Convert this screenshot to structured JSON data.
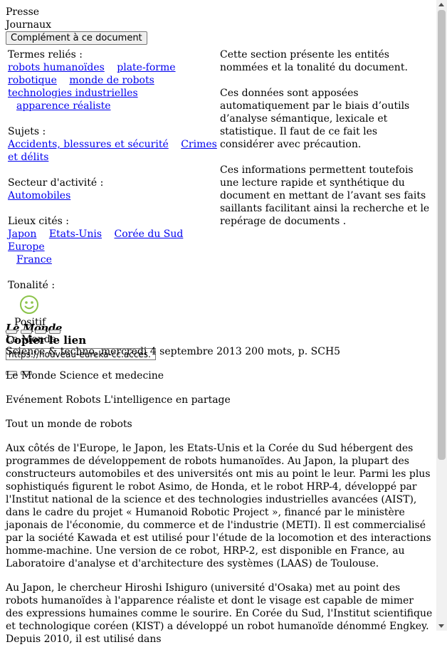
{
  "nav": {
    "presse": "Presse",
    "journaux": "Journaux",
    "complement_button": "Complément à ce document"
  },
  "complement": {
    "related_terms": {
      "label": "Termes reliés :",
      "items": [
        "robots humanoïdes",
        "plate-forme robotique",
        "monde de robots",
        "technologies industrielles",
        "apparence réaliste"
      ]
    },
    "subjects": {
      "label": "Sujets :",
      "items": [
        "Accidents, blessures et sécurité",
        "Crimes et délits"
      ]
    },
    "sector": {
      "label": "Secteur d'activité :",
      "items": [
        "Automobiles"
      ]
    },
    "places": {
      "label": "Lieux cités :",
      "items": [
        "Japon",
        "Etats-Unis",
        "Corée du Sud",
        "Europe",
        "France"
      ]
    },
    "tonality": {
      "label": "Tonalité :",
      "value": "Positif",
      "icon": "smiley-icon",
      "color": "#8bc34a"
    },
    "info": [
      "Cette section présente les entités nommées et la tonalité du document.",
      "Ces données sont apposées automatiquement par le biais d’outils d’analyse sémantique, lexicale et statistique. Il faut de ce fait les considérer avec précaution.",
      "Ces informations permettent toutefois une lecture rapide et synthétique du document en mettant de l’avant ses faits saillants facilitant ainsi la recherche et le repérage de documents ."
    ]
  },
  "document": {
    "logo": "Le Monde",
    "copy_link_title": "Copier le lien",
    "source_name": "Le Monde",
    "url_value": "https://nouveau-eureka-cc.acces.",
    "meta": "Science & techno, mercredi 4 septembre 2013 200 mots, p. SCH5",
    "supplement": "Le Monde Science et medecine",
    "section": "Evénement Robots L'intelligence en partage",
    "title": "Tout un monde de robots",
    "paragraphs": [
      "Aux côtés de l'Europe, le Japon, les Etats-Unis et la Corée du Sud hébergent des programmes de développement de robots humanoïdes. Au Japon, la plupart des constructeurs automobiles et des universités ont mis au point le leur. Parmi les plus sophistiqués figurent le robot Asimo, de Honda, et le robot HRP-4, développé par l'Institut national de la science et des technologies industrielles avancées (AIST), dans le cadre du projet « Humanoid Robotic Project », financé par le ministère japonais de l'économie, du commerce et de l'industrie (METI). Il est commercialisé par la société Kawada et est utilisé pour l'étude de la locomotion et des interactions homme-machine. Une version de ce robot, HRP-2, est disponible en France, au Laboratoire d'analyse et d'architecture des systèmes (LAAS) de Toulouse.",
      "Au Japon, le chercheur Hiroshi Ishiguro (université d'Osaka) met au point des robots humanoïdes à l'apparence réaliste et dont le visage est capable de mimer des expressions humaines comme le sourire. En Corée du Sud, l'Institut scientifique et technologique coréen (KIST) a développé un robot humanoïde dénommé Engkey. Depuis 2010, il est utilisé dans"
    ]
  }
}
